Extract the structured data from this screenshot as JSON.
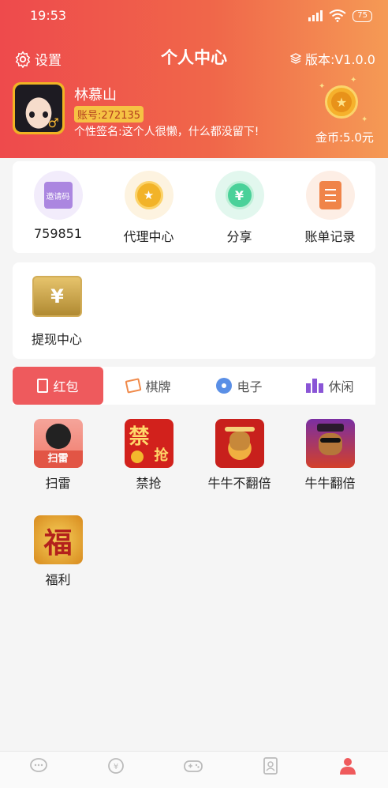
{
  "status_bar": {
    "time": "19:53",
    "battery": "75"
  },
  "header": {
    "settings_label": "设置",
    "title": "个人中心",
    "version_label": "版本:V1.0.0"
  },
  "profile": {
    "name": "林慕山",
    "account": "账号:272135",
    "signature": "个性签名:这个人很懒，什么都没留下!",
    "gold": "金币:5.0元",
    "gender_symbol": "♂"
  },
  "quick_actions": [
    {
      "label": "759851",
      "icon": "invite-code-icon",
      "icon_text": "邀请码"
    },
    {
      "label": "代理中心",
      "icon": "agent-badge-icon"
    },
    {
      "label": "分享",
      "icon": "share-yen-icon"
    },
    {
      "label": "账单记录",
      "icon": "bill-record-icon"
    }
  ],
  "withdraw": {
    "label": "提现中心",
    "icon": "withdraw-yen-icon",
    "icon_text": "¥"
  },
  "tabs": [
    {
      "label": "红包",
      "icon": "red-envelope-icon",
      "active": true
    },
    {
      "label": "棋牌",
      "icon": "playing-cards-icon",
      "active": false
    },
    {
      "label": "电子",
      "icon": "wheel-icon",
      "active": false
    },
    {
      "label": "休闲",
      "icon": "crown-icon",
      "active": false
    }
  ],
  "games": [
    {
      "label": "扫雷",
      "icon": "minesweeper-game-icon",
      "icon_text": "扫雷"
    },
    {
      "label": "禁抢",
      "icon": "no-grab-game-icon",
      "icon_text": "禁",
      "icon_text2": "抢"
    },
    {
      "label": "牛牛不翻倍",
      "icon": "bull-game-icon"
    },
    {
      "label": "牛牛翻倍",
      "icon": "bull-double-game-icon"
    },
    {
      "label": "福利",
      "icon": "welfare-game-icon",
      "icon_text": "福"
    }
  ],
  "bottom_nav": [
    {
      "icon": "chat-icon"
    },
    {
      "icon": "yen-wallet-icon"
    },
    {
      "icon": "gamepad-icon"
    },
    {
      "icon": "contacts-icon"
    },
    {
      "icon": "person-icon",
      "active": true
    }
  ],
  "colors": {
    "header_start": "#ee4a4c",
    "header_end": "#f59a55",
    "active_tab": "#ee5a5d",
    "active_nav": "#ef5a5c"
  }
}
